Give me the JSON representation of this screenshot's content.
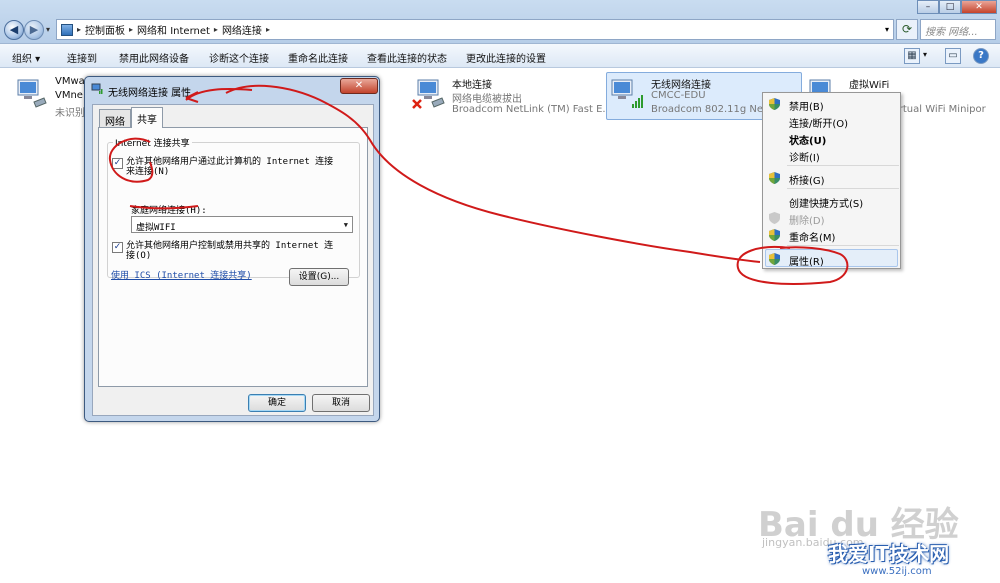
{
  "address_bar": {
    "breadcrumbs": [
      "控制面板",
      "网络和 Internet",
      "网络连接"
    ],
    "search_placeholder": "搜索 网络..."
  },
  "toolbar": {
    "items": [
      "组织 ▾",
      "连接到",
      "禁用此网络设备",
      "诊断这个连接",
      "重命名此连接",
      "查看此连接的状态",
      "更改此连接的设置"
    ]
  },
  "connections": [
    {
      "name": "VMwa",
      "line2": "VMne",
      "line3": "未识别"
    },
    {
      "name": "本地连接",
      "line2": "网络电缆被拔出",
      "line3": "Broadcom NetLink (TM) Fast E..."
    },
    {
      "name": "无线网络连接",
      "line2": "CMCC-EDU",
      "line3": "Broadcom 802.11g Netw"
    },
    {
      "name": "虚拟WiFi",
      "line2": "",
      "line3": "irtual WiFi Minipor"
    }
  ],
  "context_menu": {
    "items": [
      {
        "label": "禁用(B)"
      },
      {
        "label": "连接/断开(O)"
      },
      {
        "label": "状态(U)"
      },
      {
        "label": "诊断(I)"
      },
      {
        "label": "桥接(G)"
      },
      {
        "label": "创建快捷方式(S)"
      },
      {
        "label": "删除(D)"
      },
      {
        "label": "重命名(M)"
      },
      {
        "label": "属性(R)"
      }
    ]
  },
  "dialog": {
    "title": "无线网络连接 属性",
    "tabs": [
      "网络",
      "共享"
    ],
    "group_label": "Internet 连接共享",
    "allow_share_line1": "允许其他网络用户通过此计算机的 Internet 连接",
    "allow_share_line2": "来连接(N)",
    "home_network_label": "家庭网络连接(H):",
    "home_network_value": "虚拟WIFI",
    "allow_control_line1": "允许其他网络用户控制或禁用共享的 Internet 连",
    "allow_control_line2": "接(O)",
    "ics_link": "使用 ICS (Internet 连接共享)",
    "settings_button": "设置(G)...",
    "ok_button": "确定",
    "cancel_button": "取消"
  },
  "watermark": {
    "brand": "Bai du 经验",
    "url": "jingyan.baidu.com",
    "site": "我爱IT技术网",
    "site_url": "www.52ij.com"
  }
}
